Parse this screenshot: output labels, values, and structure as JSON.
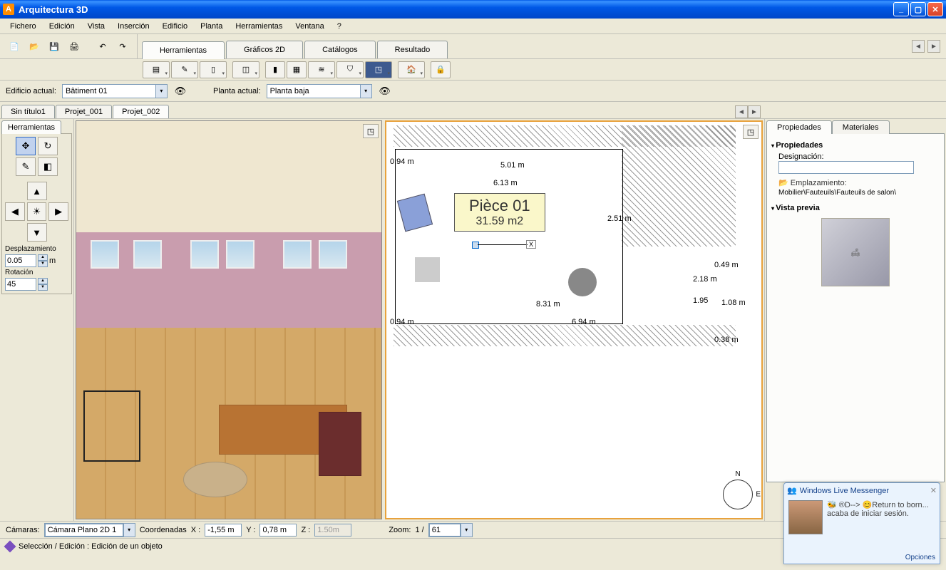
{
  "app": {
    "title": "Arquitectura 3D"
  },
  "menu": [
    "Fichero",
    "Edición",
    "Vista",
    "Inserción",
    "Edificio",
    "Planta",
    "Herramientas",
    "Ventana",
    "?"
  ],
  "main_tabs": [
    "Herramientas",
    "Gráficos 2D",
    "Catálogos",
    "Resultado"
  ],
  "main_tab_active": 0,
  "selectors": {
    "building_label": "Edificio actual:",
    "building_value": "Bâtiment 01",
    "floor_label": "Planta actual:",
    "floor_value": "Planta baja"
  },
  "doc_tabs": [
    "Sin título1",
    "Projet_001",
    "Projet_002"
  ],
  "doc_tab_active": 2,
  "tool_panel": {
    "title": "Herramientas",
    "disp_label": "Desplazamiento",
    "disp_value": "0.05",
    "disp_unit": "m",
    "rot_label": "Rotación",
    "rot_value": "45"
  },
  "plan": {
    "room_name": "Pièce 01",
    "room_area": "31.59 m2",
    "dims": {
      "d1": "0.94 m",
      "d2": "5.01 m",
      "d3": "6.13 m",
      "d4": "2.51 m",
      "d5": "8.31 m",
      "d6": "6.94 m",
      "d7": "0.94 m",
      "d8": "2.18 m",
      "d9": "1.95",
      "d10": "0.49 m",
      "d11": "1.08 m",
      "d12": "0.38 m"
    },
    "axis": "X"
  },
  "right": {
    "tabs": [
      "Propiedades",
      "Materiales"
    ],
    "tab_active": 0,
    "h_prop": "Propiedades",
    "label_desig": "Designación:",
    "desig_value": "",
    "label_loc": "Emplazamiento:",
    "loc_value": "Mobilier\\Fauteuils\\Fauteuils de salon\\",
    "h_preview": "Vista previa"
  },
  "status": {
    "cam_label": "Cámaras:",
    "cam_value": "Cámara Plano 2D 1",
    "coord_label": "Coordenadas",
    "x_label": "X :",
    "x_value": "-1,55 m",
    "y_label": "Y :",
    "y_value": "0,78 m",
    "z_label": "Z :",
    "z_value": "1.50m",
    "zoom_label": "Zoom:",
    "zoom_ratio": "1 /",
    "zoom_value": "61",
    "status_text": "Selección / Edición : Edición de un objeto"
  },
  "toast": {
    "title": "Windows Live Messenger",
    "msg_line1": "🐝 ®D--> 😊Return to born...",
    "msg_line2": "acaba de iniciar sesión.",
    "options": "Opciones"
  }
}
